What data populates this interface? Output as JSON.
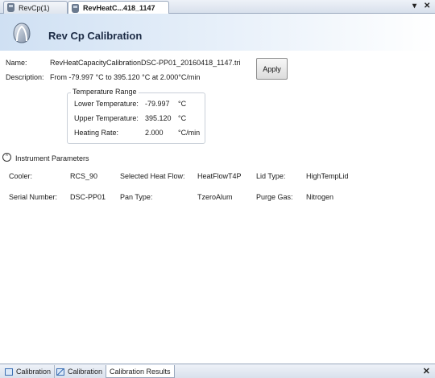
{
  "tabs": [
    {
      "label": "RevCp(1)"
    },
    {
      "label": "RevHeatC...418_1147"
    }
  ],
  "window_controls": {
    "dropdown": "▾",
    "close": "✕"
  },
  "header": {
    "title": "Rev Cp Calibration"
  },
  "form": {
    "name_label": "Name:",
    "name_value": "RevHeatCapacityCalibrationDSC-PP01_20160418_1147.tri",
    "description_label": "Description:",
    "description_value": "From -79.997 °C to 395.120 °C at 2.000°C/min",
    "apply_label": "Apply"
  },
  "temperature_range": {
    "title": "Temperature Range",
    "rows": [
      {
        "label": "Lower Temperature:",
        "value": "-79.997",
        "unit": "°C"
      },
      {
        "label": "Upper Temperature:",
        "value": "395.120",
        "unit": "°C"
      },
      {
        "label": "Heating Rate:",
        "value": "2.000",
        "unit": "°C/min"
      }
    ]
  },
  "instrument": {
    "section_label": "Instrument Parameters",
    "expander_glyph": "⌃",
    "cooler_label": "Cooler:",
    "cooler_value": "RCS_90",
    "heat_flow_label": "Selected Heat Flow:",
    "heat_flow_value": "HeatFlowT4P",
    "lid_label": "Lid Type:",
    "lid_value": "HighTempLid",
    "serial_label": "Serial Number:",
    "serial_value": "DSC-PP01",
    "pan_label": "Pan Type:",
    "pan_value": "TzeroAlum",
    "purge_label": "Purge Gas:",
    "purge_value": "Nitrogen"
  },
  "bottom_tabs": [
    {
      "label": "Calibration",
      "icon": "calibration-icon"
    },
    {
      "label": "Calibration",
      "icon": "chart-icon"
    },
    {
      "label": "Calibration Results"
    }
  ],
  "bottom_close": "✕"
}
